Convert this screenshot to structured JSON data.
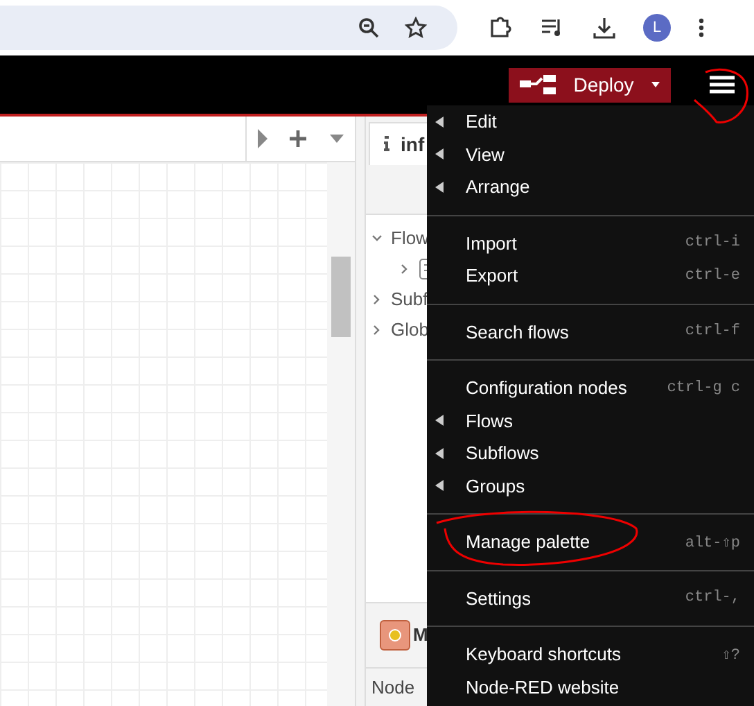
{
  "browser": {
    "avatar": "L"
  },
  "header": {
    "deploy": "Deploy"
  },
  "sidebar": {
    "tab": {
      "label": "inf",
      "selected": true
    },
    "tree": [
      {
        "label": "Flow",
        "expanded": true,
        "children": [
          {
            "expanded": false
          }
        ]
      },
      {
        "label": "Subf",
        "expanded": false
      },
      {
        "label": "Glob",
        "expanded": false
      }
    ],
    "node_title": "M",
    "table_header": "Node"
  },
  "menu": [
    {
      "kind": "submenu",
      "label": "Edit"
    },
    {
      "kind": "submenu",
      "label": "View"
    },
    {
      "kind": "submenu",
      "label": "Arrange"
    },
    {
      "kind": "divider"
    },
    {
      "kind": "item",
      "label": "Import",
      "shortcut": "ctrl-i"
    },
    {
      "kind": "item",
      "label": "Export",
      "shortcut": "ctrl-e"
    },
    {
      "kind": "divider"
    },
    {
      "kind": "item",
      "label": "Search flows",
      "shortcut": "ctrl-f"
    },
    {
      "kind": "divider"
    },
    {
      "kind": "item",
      "label": "Configuration nodes",
      "shortcut": "ctrl-g c"
    },
    {
      "kind": "submenu",
      "label": "Flows"
    },
    {
      "kind": "submenu",
      "label": "Subflows"
    },
    {
      "kind": "submenu",
      "label": "Groups"
    },
    {
      "kind": "divider"
    },
    {
      "kind": "item",
      "label": "Manage palette",
      "shortcut": "alt-⇧p"
    },
    {
      "kind": "divider"
    },
    {
      "kind": "item",
      "label": "Settings",
      "shortcut": "ctrl-,"
    },
    {
      "kind": "divider"
    },
    {
      "kind": "item",
      "label": "Keyboard shortcuts",
      "shortcut": "⇧?"
    },
    {
      "kind": "item",
      "label": "Node-RED website"
    }
  ]
}
